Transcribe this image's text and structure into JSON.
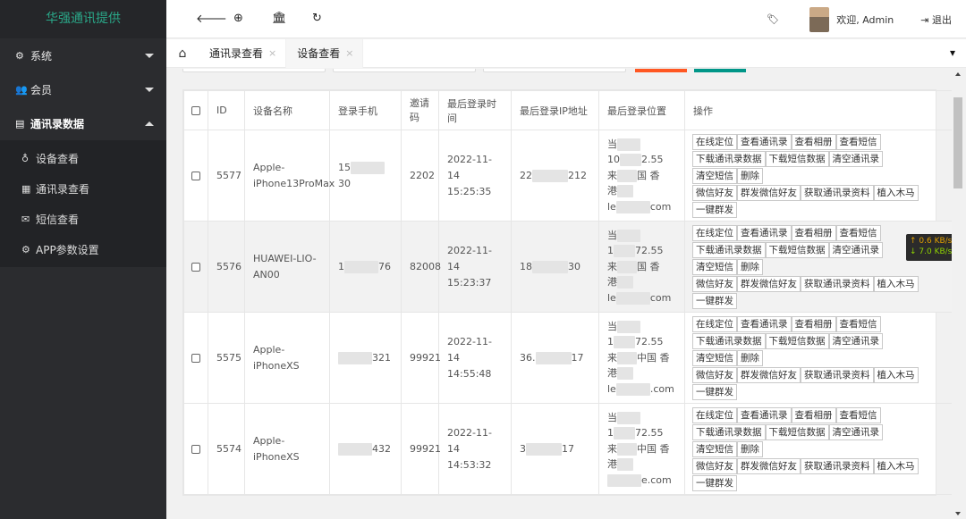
{
  "sidebar": {
    "logo": "华强通讯提供",
    "menus": [
      {
        "label": "系统",
        "icon": "⚙"
      },
      {
        "label": "会员",
        "icon": "👥"
      },
      {
        "label": "通讯录数据",
        "icon": "▤"
      }
    ],
    "submenu": [
      {
        "label": "设备查看",
        "icon": "♁"
      },
      {
        "label": "通讯录查看",
        "icon": "▦"
      },
      {
        "label": "短信查看",
        "icon": "✉"
      },
      {
        "label": "APP参数设置",
        "icon": "⚙"
      }
    ]
  },
  "topbar": {
    "icons": [
      "back-arrow-icon",
      "crosshair-icon",
      "bank-icon",
      "refresh-icon"
    ],
    "welcome": "欢迎, Admin",
    "logout": "退出"
  },
  "tabs": {
    "items": [
      {
        "label": "通讯录查看"
      },
      {
        "label": "设备查看"
      }
    ]
  },
  "table": {
    "headers": [
      "ID",
      "设备名称",
      "登录手机",
      "邀请码",
      "最后登录时间",
      "最后登录IP地址",
      "最后登录位置",
      "操作"
    ],
    "rows": [
      {
        "id": "5577",
        "device": "Apple-iPhone13ProMax",
        "phone_a": "15",
        "phone_b": "30",
        "invite": "2202",
        "date": "2022-11-14",
        "time": "15:25:35",
        "ip_a": "22",
        "ip_b": "212",
        "loc1": "当",
        "loc2a": "10",
        "loc2b": "2.55",
        "loc3a": "来",
        "loc3b": "国 香",
        "loc4": "港",
        "loc5a": "le",
        "loc5b": "com"
      },
      {
        "id": "5576",
        "device": "HUAWEI-LIO-AN00",
        "phone_a": "1",
        "phone_b": "76",
        "invite": "82008",
        "date": "2022-11-14",
        "time": "15:23:37",
        "ip_a": "18",
        "ip_b": "30",
        "loc1": "当",
        "loc2a": "1",
        "loc2b": "72.55",
        "loc3a": "来",
        "loc3b": "国 香",
        "loc4": "港",
        "loc5a": "le",
        "loc5b": "com"
      },
      {
        "id": "5575",
        "device": "Apple-iPhoneXS",
        "phone_a": "",
        "phone_b": "321",
        "invite": "99921",
        "date": "2022-11-14",
        "time": "14:55:48",
        "ip_a": "36.",
        "ip_b": "17",
        "loc1": "当",
        "loc2a": "1",
        "loc2b": "72.55",
        "loc3a": "来",
        "loc3b": "中国 香",
        "loc4": "港",
        "loc5a": "le",
        "loc5b": ".com"
      },
      {
        "id": "5574",
        "device": "Apple-iPhoneXS",
        "phone_a": "",
        "phone_b": "432",
        "invite": "99921",
        "date": "2022-11-14",
        "time": "14:53:32",
        "ip_a": "3",
        "ip_b": "17",
        "loc1": "当",
        "loc2a": "1",
        "loc2b": "72.55",
        "loc3a": "来",
        "loc3b": "中国 香",
        "loc4": "港",
        "loc5a": "",
        "loc5b": "e.com"
      }
    ],
    "ops": [
      "在线定位",
      "查看通讯录",
      "查看相册",
      "查看短信",
      "下载通讯录数据",
      "下载短信数据",
      "清空通讯录",
      "清空短信",
      "删除",
      "微信好友",
      "群发微信好友",
      "获取通讯录资料",
      "植入木马",
      "一键群发"
    ]
  },
  "speed": {
    "up": "↑ 0.6 KB/s",
    "down": "↓ 7.0 KB/s"
  }
}
